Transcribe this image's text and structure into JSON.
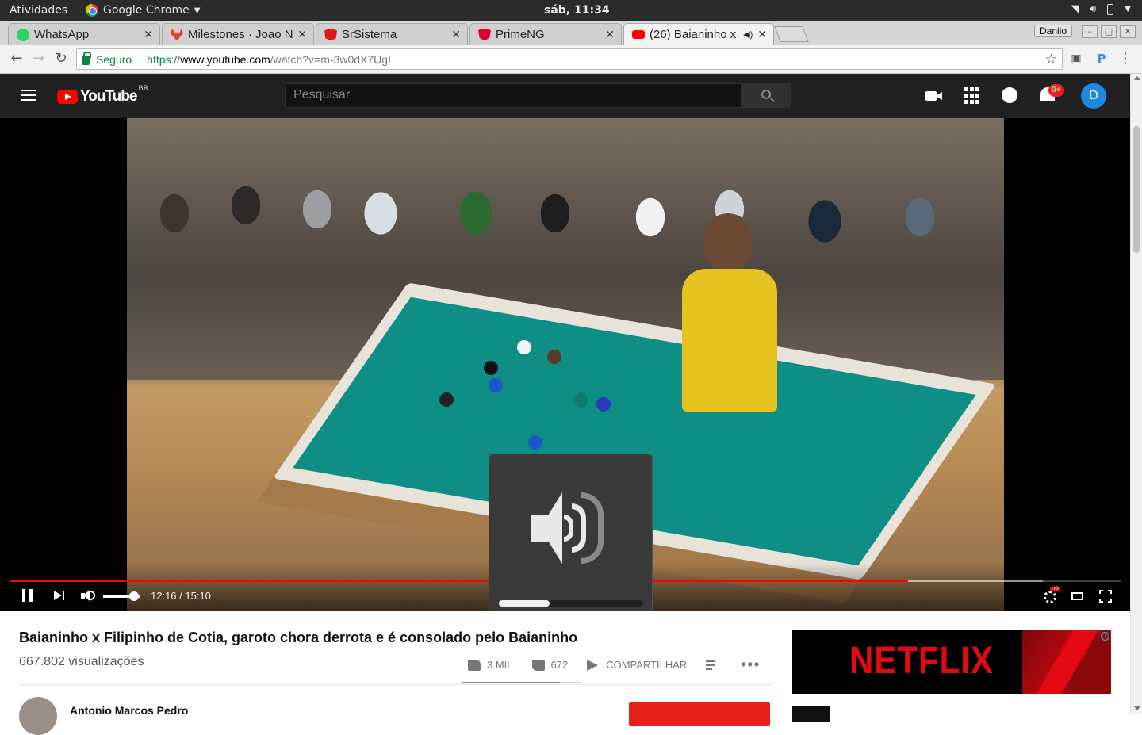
{
  "system": {
    "activities": "Atividades",
    "app_name": "Google Chrome",
    "clock": "sáb, 11:34"
  },
  "tabs": [
    {
      "title": "WhatsApp",
      "favicon": "whatsapp-icon",
      "color": "#25d366"
    },
    {
      "title": "Milestones · Joao N",
      "favicon": "gitlab-icon",
      "color": "#e24329"
    },
    {
      "title": "SrSistema",
      "favicon": "angular-icon",
      "color": "#dd1b16"
    },
    {
      "title": "PrimeNG",
      "favicon": "primeng-icon",
      "color": "#dd0031"
    },
    {
      "title": "(26) Baianinho x",
      "favicon": "youtube-icon",
      "color": "#ff0000",
      "active": true
    }
  ],
  "window": {
    "user": "Danilo"
  },
  "omnibox": {
    "secure_label": "Seguro",
    "scheme": "https://",
    "host": "www.youtube.com",
    "path": "/watch?v=m-3w0dX7UgI"
  },
  "youtube": {
    "logo_text": "YouTube",
    "region": "BR",
    "search_placeholder": "Pesquisar",
    "notification_count": "9+",
    "avatar_letter": "D"
  },
  "player": {
    "time": "12:16 / 15:10",
    "progress_fraction": 0.809,
    "buffer_fraction": 0.93,
    "volume_fraction": 0.85,
    "hd_badge": "HD"
  },
  "osd": {
    "volume_fraction": 0.35
  },
  "video": {
    "title": "Baianinho x Filipinho de Cotia, garoto chora derrota e é consolado pelo Baianinho",
    "views": "667.802 visualizações",
    "likes": "3 MIL",
    "dislikes": "672",
    "share_label": "COMPARTILHAR",
    "like_fraction": 0.82,
    "channel": "Antonio Marcos Pedro"
  },
  "ad": {
    "brand": "NETFLIX",
    "info_icon": "ⓘ"
  },
  "colors": {
    "accent": "#ff0000",
    "masthead": "#212121",
    "netflix": "#e50914"
  }
}
